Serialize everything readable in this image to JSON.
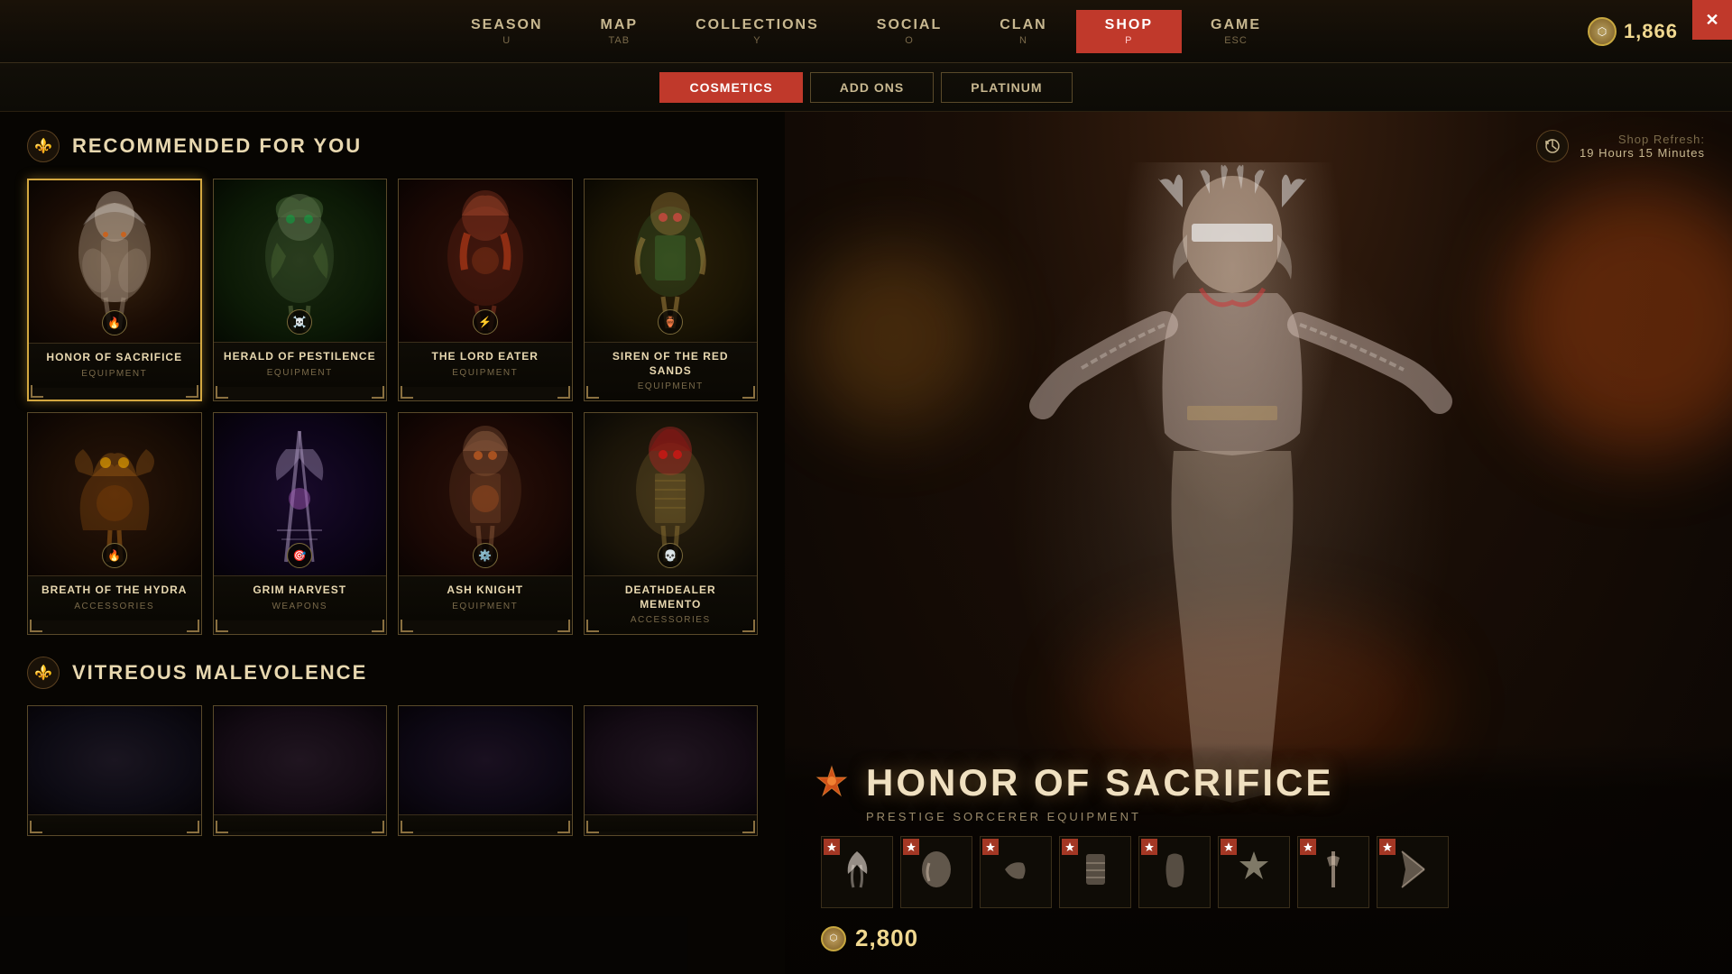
{
  "nav": {
    "items": [
      {
        "label": "SEASON",
        "key": "U"
      },
      {
        "label": "MAP",
        "key": "TAB"
      },
      {
        "label": "COLLECTIONS",
        "key": "Y"
      },
      {
        "label": "SOCIAL",
        "key": "O"
      },
      {
        "label": "CLAN",
        "key": "N"
      },
      {
        "label": "SHOP",
        "key": "P"
      },
      {
        "label": "GAME",
        "key": "ESC"
      }
    ],
    "active": "SHOP"
  },
  "sub_nav": {
    "items": [
      {
        "label": "Cosmetics"
      },
      {
        "label": "Add Ons"
      },
      {
        "label": "Platinum"
      }
    ],
    "active": "Cosmetics"
  },
  "currency": {
    "amount": "1,866"
  },
  "shop_refresh": {
    "label": "Shop Refresh:",
    "time": "19 Hours 15 Minutes"
  },
  "sections": [
    {
      "title": "Recommended for You",
      "items": [
        {
          "name": "HONOR OF SACRIFICE",
          "category": "EQUIPMENT",
          "emoji": "🪶",
          "bg_class": "item-bg-1",
          "selected": true
        },
        {
          "name": "HERALD OF PESTILENCE",
          "category": "EQUIPMENT",
          "emoji": "💀",
          "bg_class": "item-bg-2",
          "selected": false
        },
        {
          "name": "THE LORD EATER",
          "category": "EQUIPMENT",
          "emoji": "🔥",
          "bg_class": "item-bg-3",
          "selected": false
        },
        {
          "name": "SIREN OF THE RED SANDS",
          "category": "EQUIPMENT",
          "emoji": "🏺",
          "bg_class": "item-bg-4",
          "selected": false
        },
        {
          "name": "BREATH OF THE HYDRA",
          "category": "ACCESSORIES",
          "emoji": "🐉",
          "bg_class": "item-bg-5",
          "selected": false
        },
        {
          "name": "GRIM HARVEST",
          "category": "WEAPONS",
          "emoji": "⚔️",
          "bg_class": "item-bg-6",
          "selected": false
        },
        {
          "name": "ASH KNIGHT",
          "category": "EQUIPMENT",
          "emoji": "🛡️",
          "bg_class": "item-bg-7",
          "selected": false
        },
        {
          "name": "DEATHDEALER MEMENTO",
          "category": "ACCESSORIES",
          "emoji": "💀",
          "bg_class": "item-bg-8",
          "selected": false
        }
      ]
    },
    {
      "title": "Vitreous Malevolence",
      "items": []
    }
  ],
  "item_detail": {
    "title": "HONOR OF SACRIFICE",
    "subtitle": "PRESTIGE SORCERER EQUIPMENT",
    "price": "2,800",
    "pieces": [
      "🪶",
      "💎",
      "🤲",
      "👘",
      "👢",
      "✨",
      "🗡️",
      "⚡"
    ]
  },
  "close_btn": "✕"
}
